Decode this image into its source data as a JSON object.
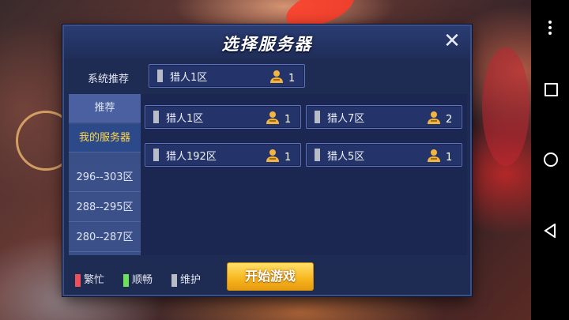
{
  "dialog": {
    "title": "选择服务器",
    "close_label": "✕"
  },
  "recommendation": {
    "label": "系统推荐",
    "server": {
      "name": "猎人1区",
      "players": "1",
      "status": "maintenance"
    }
  },
  "sidebar": {
    "items": [
      {
        "label": "推荐",
        "state": "normal"
      },
      {
        "label": "我的服务器",
        "state": "selected"
      },
      {
        "label": "296--303区",
        "state": "normal"
      },
      {
        "label": "288--295区",
        "state": "normal"
      },
      {
        "label": "280--287区",
        "state": "normal"
      }
    ]
  },
  "servers": [
    {
      "name": "猎人1区",
      "players": "1",
      "status": "maintenance"
    },
    {
      "name": "猎人7区",
      "players": "2",
      "status": "maintenance"
    },
    {
      "name": "猎人192区",
      "players": "1",
      "status": "maintenance"
    },
    {
      "name": "猎人5区",
      "players": "1",
      "status": "maintenance"
    }
  ],
  "legend": [
    {
      "label": "繁忙",
      "color": "#f0505a"
    },
    {
      "label": "顺畅",
      "color": "#6fe05a"
    },
    {
      "label": "维护",
      "color": "#b8bcc6"
    }
  ],
  "start_button": {
    "label": "开始游戏"
  },
  "colors": {
    "panel": "#1e2b52",
    "card_border": "#5b74bf",
    "selected_text": "#ffd84a",
    "player_icon": "#f2b640",
    "button": "#f6b51d"
  },
  "icons": {
    "player": "player-icon",
    "close": "close-icon",
    "nav_menu": "more-vert-icon",
    "nav_recents": "square-icon",
    "nav_home": "circle-icon",
    "nav_back": "triangle-back-icon"
  }
}
